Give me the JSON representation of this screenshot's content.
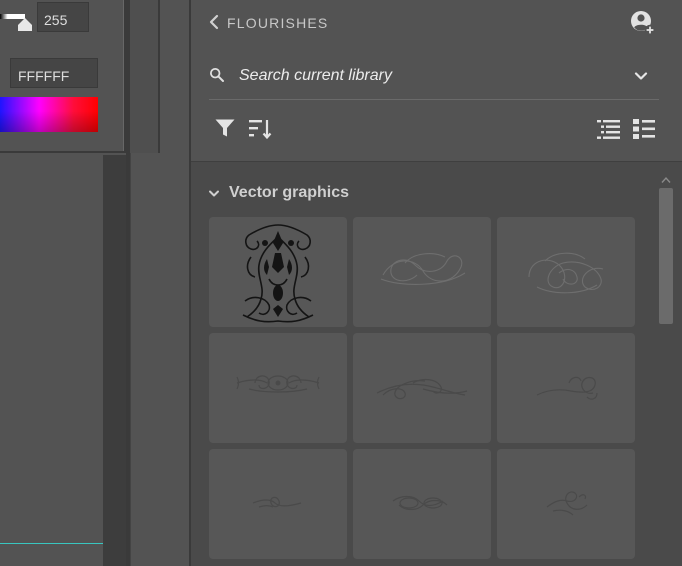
{
  "color_picker": {
    "value": "255",
    "hex": "FFFFFF"
  },
  "library": {
    "title": "FLOURISHES",
    "search_placeholder": "Search current library",
    "group": {
      "label": "Vector graphics",
      "tiles": [
        {
          "name": "ornament-symmetric-dark"
        },
        {
          "name": "flourish-loop-wide-faint"
        },
        {
          "name": "flourish-knot-faint"
        },
        {
          "name": "divider-scroll-centered"
        },
        {
          "name": "flourish-swash-long"
        },
        {
          "name": "flourish-curl-right"
        },
        {
          "name": "divider-small-loop"
        },
        {
          "name": "divider-double-loop"
        },
        {
          "name": "flourish-knot-small"
        }
      ]
    }
  },
  "colors": {
    "panel_bg": "#535353",
    "content_bg": "#4a4a4a",
    "tile_bg": "#575757",
    "accent_line": "#39c6c0"
  },
  "icons": {
    "back": "chevron-left-icon",
    "user_add": "user-add-icon",
    "search": "search-icon",
    "dropdown": "chevron-down-icon",
    "filter": "filter-icon",
    "sort": "sort-icon",
    "list_view": "list-view-icon",
    "detail_view": "detail-view-icon"
  }
}
